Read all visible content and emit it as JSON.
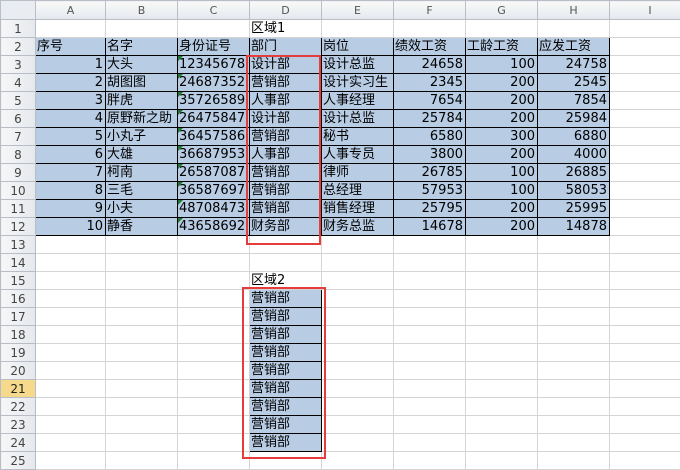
{
  "columns": [
    "",
    "A",
    "B",
    "C",
    "D",
    "E",
    "F",
    "G",
    "H",
    "I"
  ],
  "row_numbers": [
    "1",
    "2",
    "3",
    "4",
    "5",
    "6",
    "7",
    "8",
    "9",
    "10",
    "11",
    "12",
    "13",
    "14",
    "15",
    "16",
    "17",
    "18",
    "19",
    "20",
    "21",
    "22",
    "23",
    "24",
    "25"
  ],
  "active_row": "21",
  "region1_title": "区域1",
  "headers": [
    "序号",
    "名字",
    "身份证号",
    "部门",
    "岗位",
    "绩效工资",
    "工龄工资",
    "应发工资"
  ],
  "rows": [
    [
      "1",
      "大头",
      "12345678",
      "设计部",
      "设计总监",
      "24658",
      "100",
      "24758"
    ],
    [
      "2",
      "胡图图",
      "24687352",
      "营销部",
      "设计实习生",
      "2345",
      "200",
      "2545"
    ],
    [
      "3",
      "胖虎",
      "35726589",
      "人事部",
      "人事经理",
      "7654",
      "200",
      "7854"
    ],
    [
      "4",
      "原野新之助",
      "26475847",
      "设计部",
      "设计总监",
      "25784",
      "200",
      "25984"
    ],
    [
      "5",
      "小丸子",
      "36457586",
      "营销部",
      "秘书",
      "6580",
      "300",
      "6880"
    ],
    [
      "6",
      "大雄",
      "36687953",
      "人事部",
      "人事专员",
      "3800",
      "200",
      "4000"
    ],
    [
      "7",
      "柯南",
      "26587087",
      "营销部",
      "律师",
      "26785",
      "100",
      "26885"
    ],
    [
      "8",
      "三毛",
      "36587697",
      "营销部",
      "总经理",
      "57953",
      "100",
      "58053"
    ],
    [
      "9",
      "小夫",
      "48708473",
      "营销部",
      "销售经理",
      "25795",
      "200",
      "25995"
    ],
    [
      "10",
      "静香",
      "43658692",
      "财务部",
      "财务总监",
      "14678",
      "200",
      "14878"
    ]
  ],
  "region2_title": "区域2",
  "region2_values": [
    "营销部",
    "营销部",
    "营销部",
    "营销部",
    "营销部",
    "营销部",
    "营销部",
    "营销部",
    "营销部"
  ],
  "colors": {
    "cell_fill": "#b8cce4",
    "highlight_border": "#e53c3c",
    "number_as_text_marker": "#1e7b34",
    "active_row_header": "#f7d98b"
  }
}
